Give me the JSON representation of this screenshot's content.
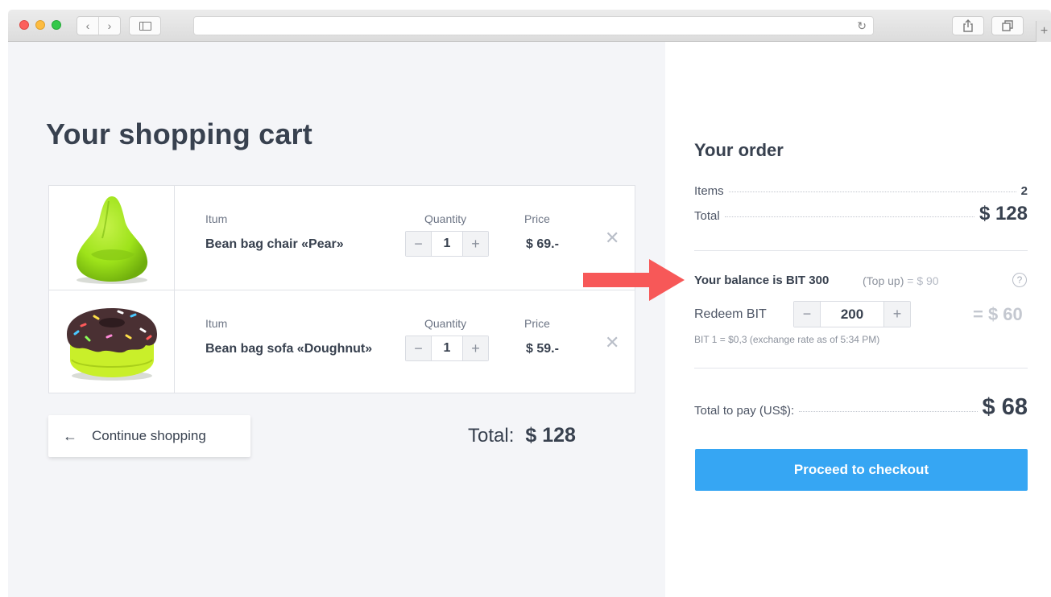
{
  "browser": {
    "back": "‹",
    "forward": "›",
    "reload": "↻",
    "new_tab": "+"
  },
  "cart": {
    "title": "Your shopping cart",
    "columns": {
      "item": "Itum",
      "quantity": "Quantity",
      "price": "Price"
    },
    "items": [
      {
        "name": "Bean bag chair «Pear»",
        "quantity": "1",
        "price": "$ 69.-",
        "image_icon": "pear-bean-bag-chair"
      },
      {
        "name": "Bean bag sofa «Doughnut»",
        "quantity": "1",
        "price": "$ 59.-",
        "image_icon": "doughnut-bean-bag-sofa"
      }
    ],
    "stepper": {
      "minus": "−",
      "plus": "+"
    },
    "remove": "✕",
    "continue_label": "Continue shopping",
    "continue_arrow": "←",
    "total_label": "Total:",
    "total_value": "$ 128"
  },
  "order": {
    "title": "Your order",
    "items_label": "Items",
    "items_value": "2",
    "total_label": "Total",
    "total_value": "$ 128",
    "balance_text": "Your balance is BIT 300",
    "topup_link": "(Top up)",
    "topup_value": "= $ 90",
    "help": "?",
    "redeem_label": "Redeem BIT",
    "redeem_amount": "200",
    "redeem_value": "= $ 60",
    "rate_note": "BIT 1 = $0,3 (exchange rate as of 5:34 PM)",
    "pay_label": "Total to pay (US$):",
    "pay_value": "$ 68",
    "checkout_label": "Proceed to checkout"
  },
  "colors": {
    "accent": "#36a6f3",
    "arrow": "#f75858",
    "pear_green": "#9ee31a",
    "doughnut_brown": "#4a3033"
  }
}
